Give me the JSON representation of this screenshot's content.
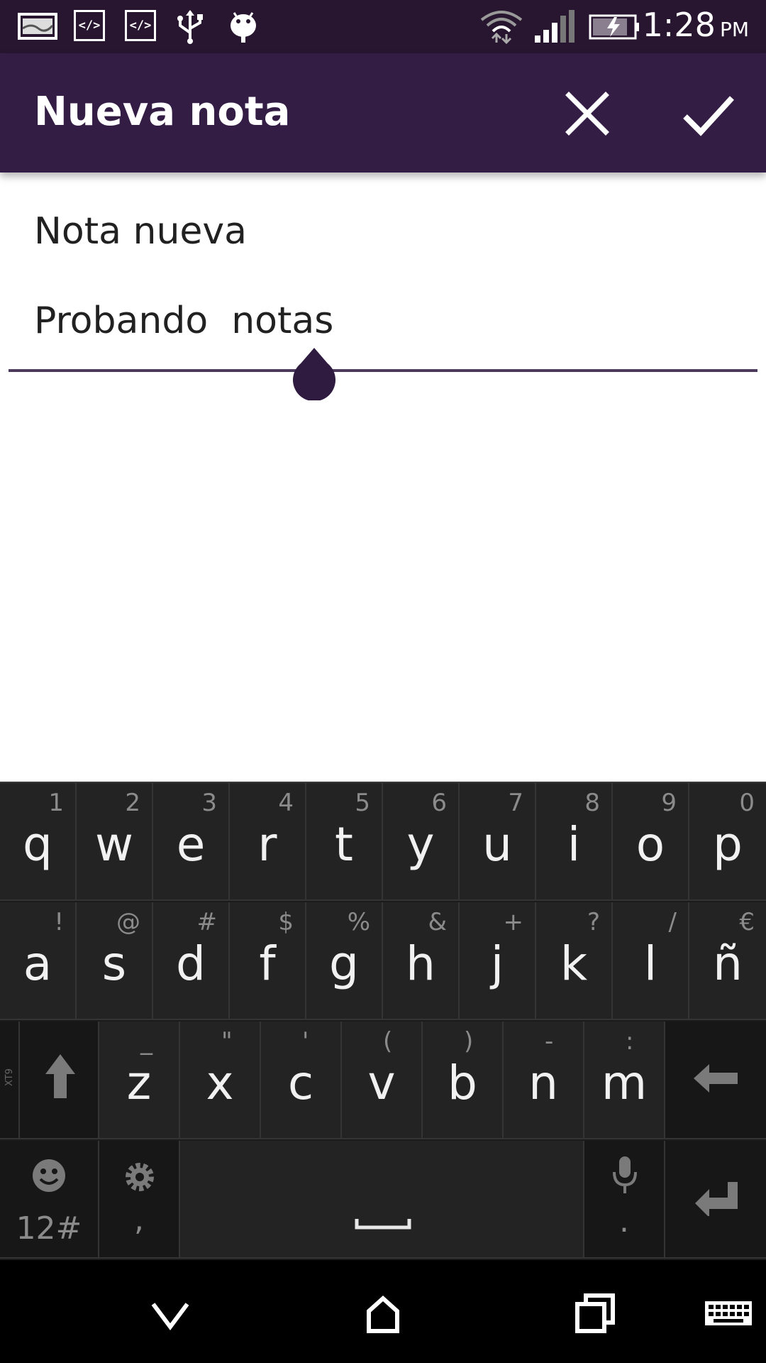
{
  "status_bar": {
    "time": "1:28",
    "ampm": "PM",
    "icons": [
      "gallery-notification-icon",
      "code-notification-icon",
      "code-notification-icon",
      "usb-icon",
      "android-debug-icon",
      "wifi-icon",
      "signal-icon",
      "battery-charging-icon"
    ]
  },
  "app_bar": {
    "title": "Nueva nota",
    "cancel_icon": "close-icon",
    "confirm_icon": "check-icon",
    "background": "#341d45"
  },
  "note": {
    "title": "Nota nueva",
    "body": "Probando  notas"
  },
  "keyboard": {
    "row1": [
      {
        "main": "q",
        "sec": "1"
      },
      {
        "main": "w",
        "sec": "2"
      },
      {
        "main": "e",
        "sec": "3"
      },
      {
        "main": "r",
        "sec": "4"
      },
      {
        "main": "t",
        "sec": "5"
      },
      {
        "main": "y",
        "sec": "6"
      },
      {
        "main": "u",
        "sec": "7"
      },
      {
        "main": "i",
        "sec": "8"
      },
      {
        "main": "o",
        "sec": "9"
      },
      {
        "main": "p",
        "sec": "0"
      }
    ],
    "row2": [
      {
        "main": "a",
        "sec": "!"
      },
      {
        "main": "s",
        "sec": "@"
      },
      {
        "main": "d",
        "sec": "#"
      },
      {
        "main": "f",
        "sec": "$"
      },
      {
        "main": "g",
        "sec": "%"
      },
      {
        "main": "h",
        "sec": "&"
      },
      {
        "main": "j",
        "sec": "+"
      },
      {
        "main": "k",
        "sec": "?"
      },
      {
        "main": "l",
        "sec": "/"
      },
      {
        "main": "ñ",
        "sec": "€"
      }
    ],
    "row3": [
      {
        "main": "z",
        "sec": "_"
      },
      {
        "main": "x",
        "sec": "\""
      },
      {
        "main": "c",
        "sec": "'"
      },
      {
        "main": "v",
        "sec": "("
      },
      {
        "main": "b",
        "sec": ")"
      },
      {
        "main": "n",
        "sec": "-"
      },
      {
        "main": "m",
        "sec": ":"
      }
    ],
    "xt9_label": "XT9",
    "symbols_label": "12#",
    "comma_label": ",",
    "period_label": "."
  },
  "nav_bar": {
    "buttons": [
      "back-icon",
      "home-icon",
      "recents-icon",
      "keyboard-icon"
    ]
  }
}
